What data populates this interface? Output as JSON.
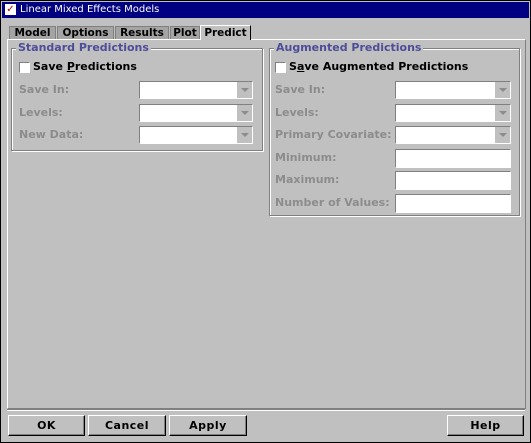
{
  "window": {
    "title": "Linear Mixed Effects Models"
  },
  "tabs": [
    "Model",
    "Options",
    "Results",
    "Plot",
    "Predict"
  ],
  "active_tab": "Predict",
  "standard": {
    "legend": "Standard Predictions",
    "save_checkbox": {
      "label_pre": "Save ",
      "label_key": "P",
      "label_post": "redictions",
      "checked": false
    },
    "save_in_label": "Save In:",
    "levels_label": "Levels:",
    "new_data_label": "New Data:"
  },
  "augmented": {
    "legend": "Augmented Predictions",
    "save_checkbox": {
      "label_pre": "S",
      "label_key": "a",
      "label_post": "ve Augmented Predictions",
      "checked": false
    },
    "save_in_label": "Save In:",
    "levels_label": "Levels:",
    "primary_cov_label": "Primary Covariate:",
    "minimum_label": "Minimum:",
    "maximum_label": "Maximum:",
    "num_values_label": "Number of Values:"
  },
  "buttons": {
    "ok": "OK",
    "cancel": "Cancel",
    "apply": "Apply",
    "help": "Help"
  },
  "colors": {
    "title_bar": "#000080",
    "face": "#c0c0c0",
    "legend_text": "#4d4d99",
    "disabled_text": "#8c8c8c"
  }
}
